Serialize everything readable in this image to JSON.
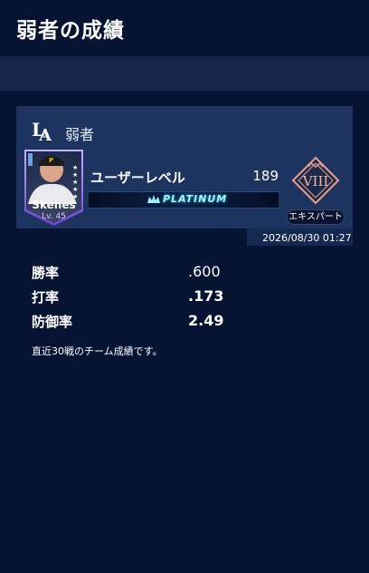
{
  "page": {
    "title": "弱者の成績"
  },
  "team": {
    "name": "弱者",
    "logo_icon": "dodgers-la-logo-icon"
  },
  "player": {
    "name": "Skenes",
    "level": "Lv. 45",
    "stars": 5
  },
  "user": {
    "level_label": "ユーザーレベル",
    "level_value": "189"
  },
  "tier": {
    "label": "PLATINUM",
    "color": "#9ff3ff"
  },
  "rank": {
    "numeral": "VIII",
    "label": "エキスパート"
  },
  "timestamp": "2026/08/30  01:27",
  "stats": [
    {
      "label": "勝率",
      "value": ".600"
    },
    {
      "label": "打率",
      "value": ".173"
    },
    {
      "label": "防御率",
      "value": "2.49"
    }
  ],
  "note": "直近30戦のチーム成績です。",
  "colors": {
    "background": "#061333",
    "card": "#1d3461",
    "band": "#15264a",
    "accent": "#e8a08a"
  }
}
